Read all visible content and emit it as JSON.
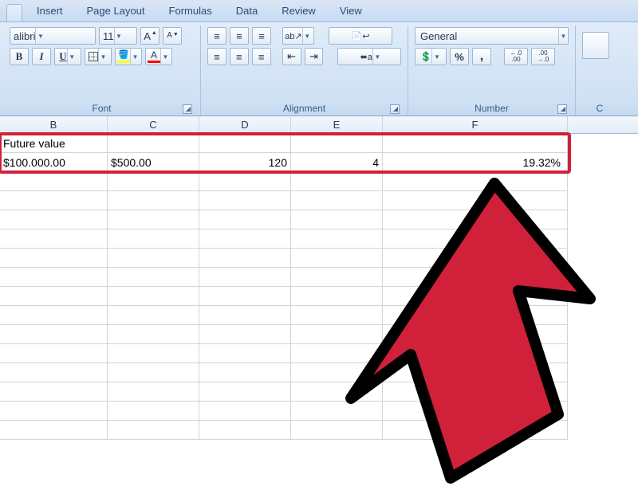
{
  "tabs": {
    "insert": "Insert",
    "pageLayout": "Page Layout",
    "formulas": "Formulas",
    "data": "Data",
    "review": "Review",
    "view": "View"
  },
  "font": {
    "name_partial": "alibri",
    "size": "11",
    "groupTitle": "Font",
    "bold": "B",
    "italic": "I",
    "underline": "U",
    "growA": "A",
    "shrinkA": "A",
    "fontcolorA": "A"
  },
  "alignment": {
    "groupTitle": "Alignment"
  },
  "number": {
    "format": "General",
    "groupTitle": "Number",
    "percent": "%",
    "comma": ",",
    "incDec": ".0",
    "incDec2": ".00",
    "decInc": ".00",
    "decInc2": ".0"
  },
  "more": {
    "letter": "C"
  },
  "columns": {
    "B": "B",
    "C": "C",
    "D": "D",
    "E": "E",
    "F": "F"
  },
  "cells": {
    "B1": "Future value",
    "B2": "$100.000.00",
    "C2": "$500.00",
    "D2": "120",
    "E2": "4",
    "F2": "19.32%"
  }
}
